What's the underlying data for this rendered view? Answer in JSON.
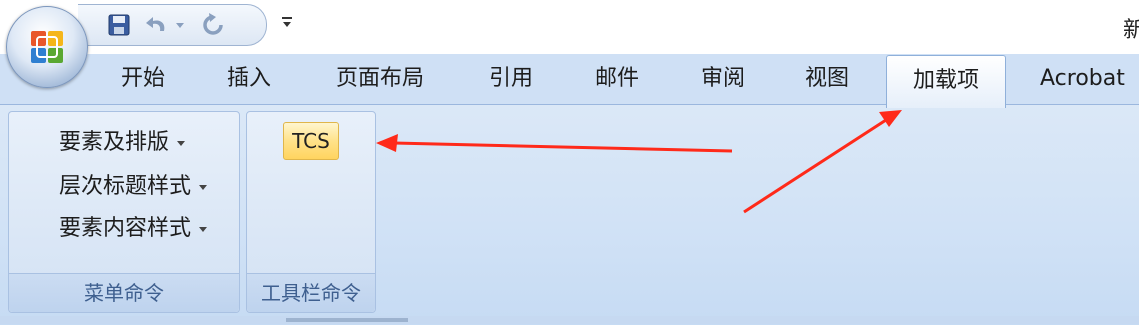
{
  "title_bar": {
    "partial_title": "新"
  },
  "tabs": [
    {
      "label": "开始"
    },
    {
      "label": "插入"
    },
    {
      "label": "页面布局"
    },
    {
      "label": "引用"
    },
    {
      "label": "邮件"
    },
    {
      "label": "审阅"
    },
    {
      "label": "视图"
    },
    {
      "label": "加载项",
      "active": true
    },
    {
      "label": "Acrobat"
    }
  ],
  "ribbon": {
    "menu_group": {
      "label": "菜单命令",
      "items": [
        {
          "label": "要素及排版"
        },
        {
          "label": "层次标题样式"
        },
        {
          "label": "要素内容样式"
        }
      ]
    },
    "toolbar_group": {
      "label": "工具栏命令",
      "button_label": "TCS"
    }
  },
  "annotation": {
    "arrow_color": "#ff2a1a"
  },
  "colors": {
    "tab_strip": "#cfe0f5",
    "ribbon": "#d1e2f6",
    "group_label": "#3e5f8f",
    "tcs_button": "#ffd45f"
  }
}
